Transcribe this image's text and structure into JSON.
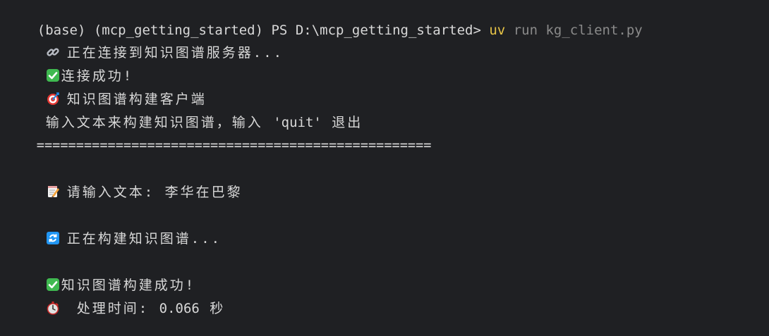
{
  "terminal": {
    "prompt": "(base) (mcp_getting_started) PS D:\\mcp_getting_started> ",
    "command": "uv",
    "command_args": " run kg_client.py",
    "lines": {
      "connecting": "正在连接到知识图谱服务器...",
      "connected": "连接成功!",
      "client_title": "知识图谱构建客户端",
      "instruction_pre": "输入文本来构建知识图谱，输入 ",
      "instruction_quit": "'quit'",
      "instruction_post": " 退出",
      "separator": "==================================================",
      "input_prompt": "请输入文本: ",
      "input_value": "李华在巴黎",
      "building": "正在构建知识图谱...",
      "built": "知识图谱构建成功!",
      "time_label": "处理时间: ",
      "time_value": "0.066",
      "time_unit": " 秒"
    },
    "icons": {
      "connecting": "link-icon",
      "connected": "check-mark-icon",
      "client_title": "target-icon",
      "input": "memo-icon",
      "building": "refresh-icon",
      "built": "check-mark-icon",
      "time": "stopwatch-icon"
    },
    "colors": {
      "background": "#1f2023",
      "text": "#d8d8d8",
      "command": "#e8c547",
      "args": "#8a8a8a",
      "check_green": "#3fb950"
    }
  }
}
